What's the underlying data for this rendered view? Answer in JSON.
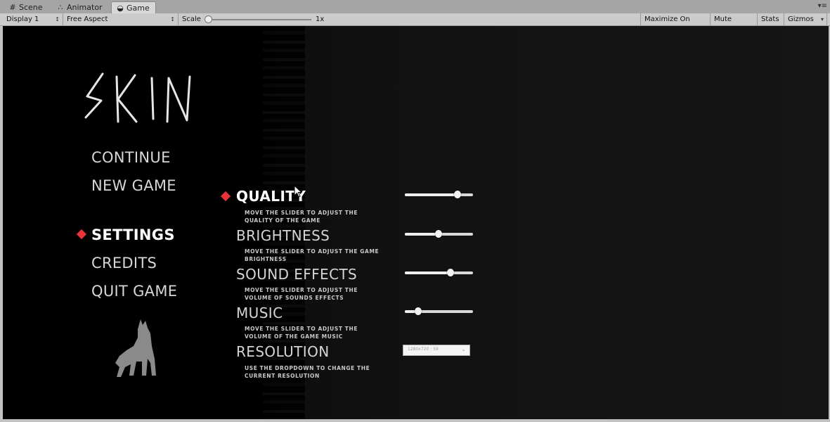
{
  "tabs": [
    {
      "label": "Scene",
      "icon": "grid-icon"
    },
    {
      "label": "Animator",
      "icon": "animator-icon"
    },
    {
      "label": "Game",
      "icon": "game-icon",
      "active": true
    }
  ],
  "toolbar": {
    "display": "Display 1",
    "aspect": "Free Aspect",
    "scale_label": "Scale",
    "scale_value": "1x",
    "maximize": "Maximize On Play",
    "mute": "Mute Audio",
    "stats": "Stats",
    "gizmos": "Gizmos"
  },
  "game": {
    "logo_text": "SKIN",
    "menu": [
      {
        "label": "CONTINUE"
      },
      {
        "label": "NEW GAME"
      },
      {
        "label": "SETTINGS",
        "selected": true
      },
      {
        "label": "CREDITS"
      },
      {
        "label": "QUIT GAME"
      }
    ],
    "settings": [
      {
        "title": "QUALITY",
        "desc": "MOVE THE SLIDER TO ADJUST THE QUALITY OF THE GAME",
        "slider": 0.77,
        "selected": true
      },
      {
        "title": "BRIGHTNESS",
        "desc": "MOVE THE SLIDER TO ADJUST THE GAME BRIGHTNESS",
        "slider": 0.49
      },
      {
        "title": "SOUND EFFECTS",
        "desc": "MOVE THE SLIDER TO ADJUST THE VOLUME OF SOUNDS EFFECTS",
        "slider": 0.67
      },
      {
        "title": "MUSIC",
        "desc": "MOVE THE SLIDER TO ADJUST THE VOLUME OF THE GAME MUSIC",
        "slider": 0.2
      },
      {
        "title": "RESOLUTION",
        "desc": "USE THE DROPDOWN TO CHANGE THE CURRENT RESOLUTION"
      }
    ],
    "resolution_value": "1280x720 : 59",
    "colors": {
      "accent": "#e8333a",
      "background": "#000000"
    }
  }
}
